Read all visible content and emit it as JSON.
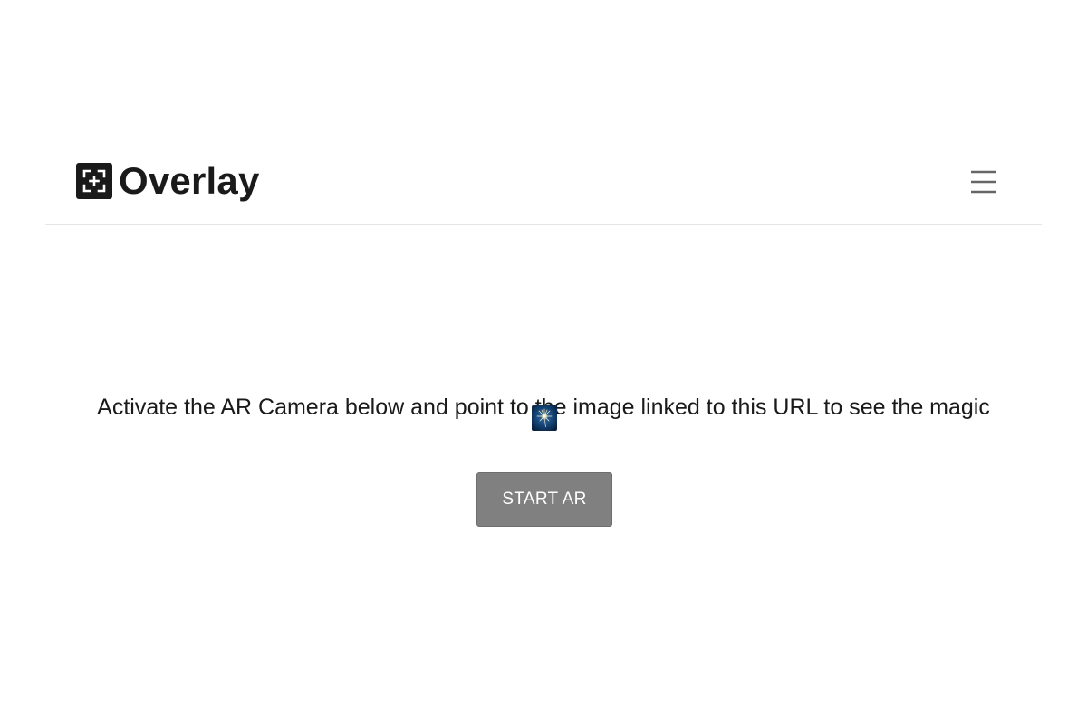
{
  "header": {
    "brand_name": "Overlay",
    "logo_icon": "ar-scan-frame-icon",
    "menu_icon": "hamburger-menu-icon"
  },
  "main": {
    "message": "Activate the AR Camera below and point to the image linked to this URL to see the magic",
    "target_image_icon": "sparkler-image-thumbnail",
    "start_button_label": "START AR"
  },
  "colors": {
    "text": "#1a1a1a",
    "button_bg": "#808080",
    "button_text": "#ffffff",
    "divider": "#e6e6e6",
    "menu_icon": "#666666"
  }
}
